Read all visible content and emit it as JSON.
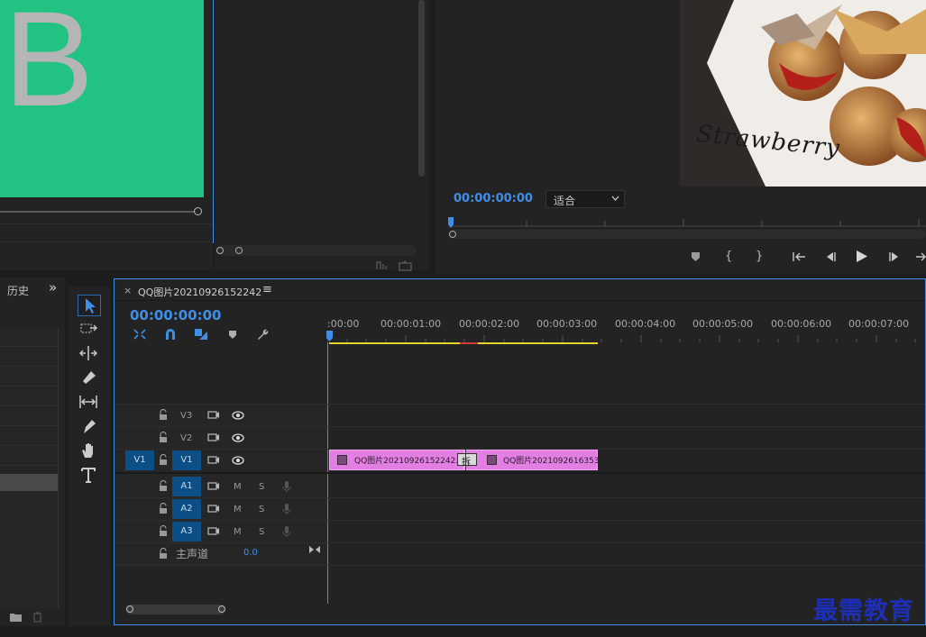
{
  "left_panel": {
    "history_tab": "历史",
    "expand_glyph": "»"
  },
  "source_monitor": {
    "preview_letter": "B",
    "preview_color": "#22c283"
  },
  "program_monitor": {
    "timecode": "00:00:00:00",
    "fit_select": "适合",
    "overlay_text": "Strawberry"
  },
  "timeline": {
    "close_glyph": "×",
    "sequence_name": "QQ图片20210926152242",
    "menu_glyph": "≡",
    "timecode": "00:00:00:00",
    "ruler": [
      ":00:00",
      "00:00:01:00",
      "00:00:02:00",
      "00:00:03:00",
      "00:00:04:00",
      "00:00:05:00",
      "00:00:06:00",
      "00:00:07:00"
    ],
    "tracks": {
      "v3": "V3",
      "v2": "V2",
      "v1_src": "V1",
      "v1": "V1",
      "a1": "A1",
      "a2": "A2",
      "a3": "A3",
      "mute": "M",
      "solo": "S",
      "master_label": "主声道",
      "master_value": "0.0"
    },
    "clips": {
      "clip1": "QQ图片20210926152242.",
      "clip2": "QQ图片2021092616353",
      "transition_label": "拆"
    },
    "clip_color": "#e37ee2"
  },
  "watermark": "最需教育"
}
